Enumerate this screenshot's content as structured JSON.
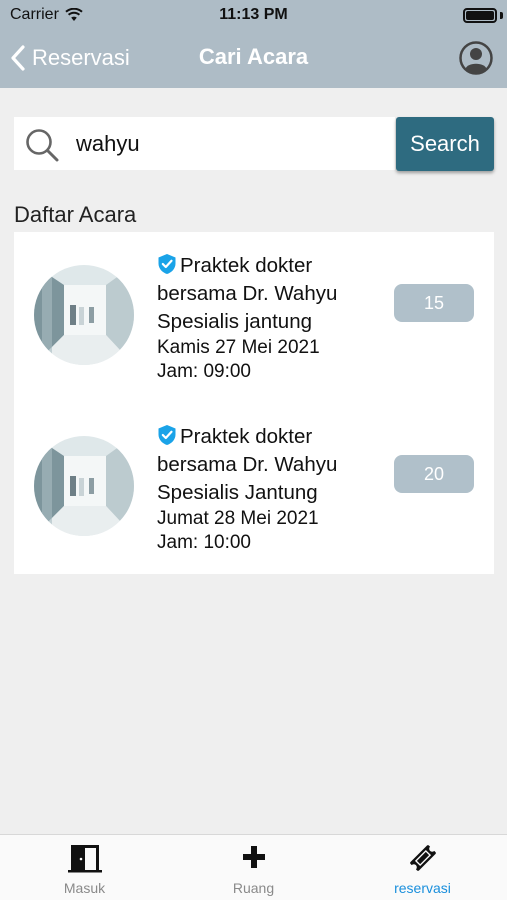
{
  "status_bar": {
    "carrier": "Carrier",
    "time": "11:13 PM"
  },
  "nav": {
    "back_label": "Reservasi",
    "title": "Cari Acara"
  },
  "search": {
    "value": "wahyu",
    "button_label": "Search"
  },
  "list": {
    "heading": "Daftar Acara",
    "items": [
      {
        "title": "Praktek dokter bersama Dr. Wahyu Spesialis jantung",
        "date": "Kamis 27 Mei 2021",
        "time": "Jam: 09:00",
        "count": "15"
      },
      {
        "title": "Praktek dokter bersama Dr. Wahyu Spesialis Jantung",
        "date": "Jumat 28 Mei 2021",
        "time": "Jam: 10:00",
        "count": "20"
      }
    ]
  },
  "tabs": [
    {
      "label": "Masuk",
      "icon": "door-icon"
    },
    {
      "label": "Ruang",
      "icon": "plus-icon"
    },
    {
      "label": "reservasi",
      "icon": "ticket-icon",
      "active": true
    }
  ],
  "colors": {
    "header": "#aebcc6",
    "search_button": "#2e6b80",
    "badge": "#b0c0ca",
    "active_tab": "#1a8fdc",
    "verified": "#1aa3e8"
  }
}
